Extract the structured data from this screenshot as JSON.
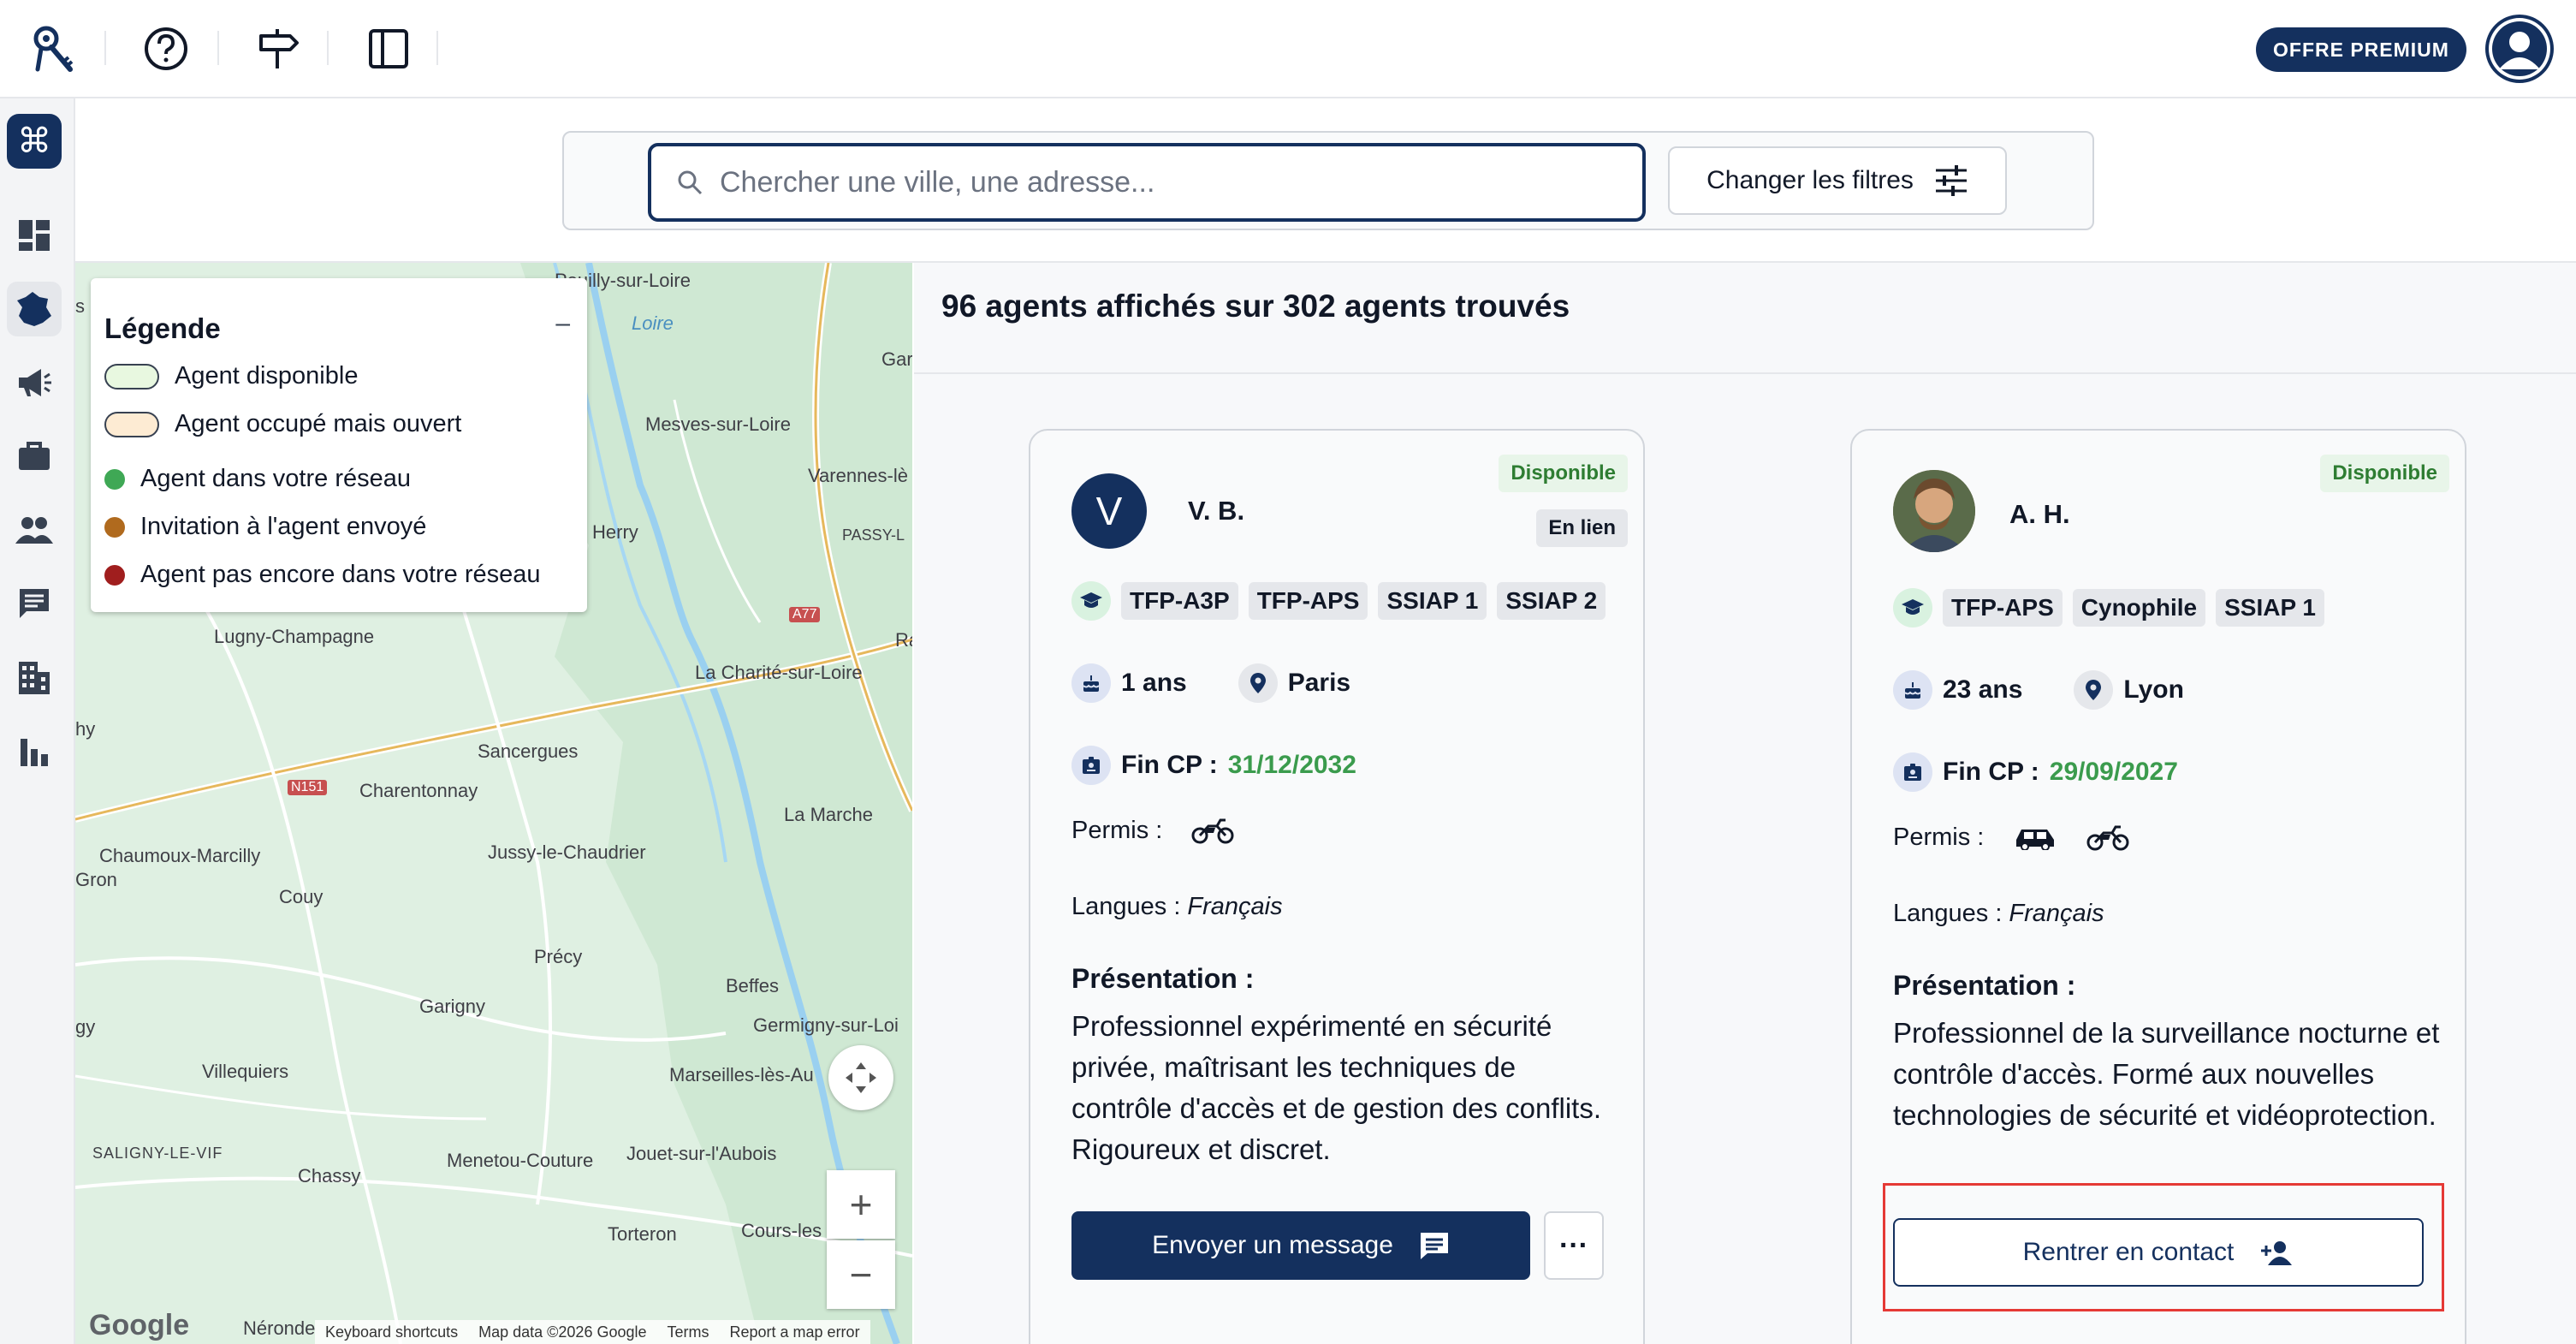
{
  "topbar": {
    "icons": [
      "logo-keys-icon",
      "help-icon",
      "signpost-icon",
      "sidebar-toggle-icon"
    ],
    "premium_label": "OFFRE PREMIUM"
  },
  "rail": {
    "items": [
      "command-icon",
      "dashboard-icon",
      "map-france-icon",
      "megaphone-icon",
      "briefcase-icon",
      "people-icon",
      "chat-icon",
      "building-icon",
      "bar-chart-icon"
    ],
    "active": "map-france-icon"
  },
  "search": {
    "placeholder": "Chercher une ville, une adresse...",
    "value": "",
    "filters_label": "Changer les filtres"
  },
  "legend": {
    "title": "Légende",
    "collapse": "–",
    "items": [
      {
        "label": "Agent disponible",
        "kind": "pill",
        "color": "#e8f8e0"
      },
      {
        "label": "Agent occupé mais ouvert",
        "kind": "pill",
        "color": "#fdebd3"
      },
      {
        "label": "Agent dans votre réseau",
        "kind": "dot",
        "color": "#3fa855"
      },
      {
        "label": "Invitation à l'agent envoyé",
        "kind": "dot",
        "color": "#b06a1e"
      },
      {
        "label": "Agent pas encore dans votre réseau",
        "kind": "dot",
        "color": "#a01e1e"
      }
    ]
  },
  "map": {
    "places": [
      "Pouilly-sur-Loire",
      "Loire",
      "Gar",
      "Mesves-sur-Loire",
      "Varennes-lè",
      "Herry",
      "PASSY-L",
      "A77",
      "Ra",
      "Lugny-Champagne",
      "La Charité-sur-Loire",
      "hy",
      "Sancergues",
      "N151",
      "Charentonnay",
      "La Marche",
      "Chaumoux-Marcilly",
      "Jussy-le-Chaudrier",
      "Gron",
      "Couy",
      "Précy",
      "Beffes",
      "Garigny",
      "Germigny-sur-Loi",
      "gy",
      "Villequiers",
      "Marseilles-lès-Au",
      "SALIGNY-LE-VIF",
      "Chassy",
      "Menetou-Couture",
      "Jouet-sur-l'Aubois",
      "Torteron",
      "Cours-les",
      "Néronde",
      "s"
    ],
    "google": "Google",
    "attribution": [
      "Keyboard shortcuts",
      "Map data ©2026 Google",
      "Terms",
      "Report a map error"
    ],
    "zoom_in": "+",
    "zoom_out": "−"
  },
  "results": {
    "title": "96 agents affichés sur 302 agents trouvés",
    "cards": [
      {
        "initial": "V",
        "name": "V. B.",
        "status": "Disponible",
        "link_badge": "En lien",
        "tags": [
          "TFP-A3P",
          "TFP-APS",
          "SSIAP 1",
          "SSIAP 2"
        ],
        "age": "1 ans",
        "city": "Paris",
        "fin_cp_label": "Fin CP :",
        "fin_cp": "31/12/2032",
        "permis_label": "Permis :",
        "permis": [
          "moto-icon"
        ],
        "langues_label": "Langues :",
        "langues": "Français",
        "presentation_label": "Présentation :",
        "presentation": "Professionnel expérimenté en sécurité privée, maîtrisant les techniques de contrôle d'accès et de gestion des conflits. Rigoureux et discret.",
        "action_label": "Envoyer un message",
        "more_label": "···"
      },
      {
        "initial": "",
        "name": "A. H.",
        "status": "Disponible",
        "tags": [
          "TFP-APS",
          "Cynophile",
          "SSIAP 1"
        ],
        "age": "23 ans",
        "city": "Lyon",
        "fin_cp_label": "Fin CP :",
        "fin_cp": "29/09/2027",
        "permis_label": "Permis :",
        "permis": [
          "car-icon",
          "moto-icon"
        ],
        "langues_label": "Langues :",
        "langues": "Français",
        "presentation_label": "Présentation :",
        "presentation": "Professionnel de la surveillance nocturne et contrôle d'accès. Formé aux nouvelles technologies de sécurité et vidéoprotection.",
        "action_label": "Rentrer en contact"
      }
    ]
  },
  "colors": {
    "brand": "#14305e",
    "available": "#2e7d32",
    "date_green": "#3b9b4d",
    "highlight": "#e53935"
  }
}
